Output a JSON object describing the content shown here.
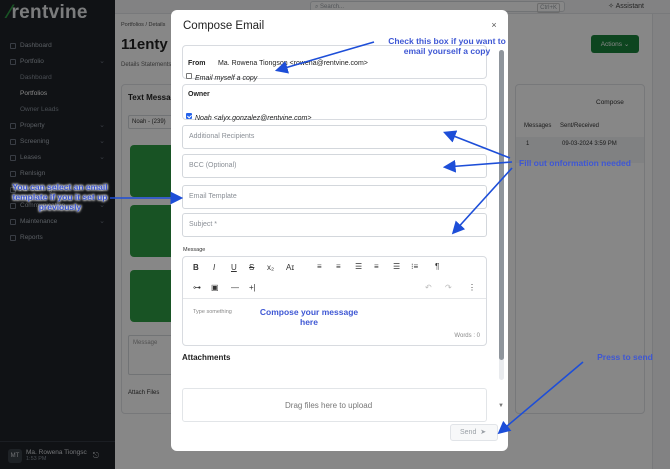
{
  "app": {
    "logo": "rentvine",
    "search_placeholder": "Search...",
    "search_shortcut": "Ctrl+K",
    "assistant_label": "Assistant"
  },
  "sidebar": {
    "items": [
      {
        "label": "Dashboard"
      },
      {
        "label": "Portfolio"
      },
      {
        "label": "Dashboard"
      },
      {
        "label": "Portfolios"
      },
      {
        "label": "Owner Leads"
      },
      {
        "label": "Property"
      },
      {
        "label": "Screening"
      },
      {
        "label": "Leases"
      },
      {
        "label": "Renlsign"
      },
      {
        "label": "Accounting"
      },
      {
        "label": "Communication"
      },
      {
        "label": "Maintenance"
      },
      {
        "label": "Reports"
      }
    ],
    "user_initials": "MT",
    "user_name": "Ma. Rowena Tiongsc",
    "user_time": "1:53 PM"
  },
  "page": {
    "breadcrumb": "Portfolios / Details",
    "title": "11enty",
    "tabs_text": "Details  Statements",
    "actions_label": "Actions",
    "text_messages_title": "Text Messages",
    "contact_select": "Noah - (239)",
    "compose_label": "Compose",
    "table_headers": [
      "Messages",
      "Sent/Received"
    ],
    "table_row": [
      "1",
      "09-03-2024 3:59 PM"
    ],
    "message_placeholder": "Message",
    "attach_label": "Attach Files"
  },
  "modal": {
    "title": "Compose Email",
    "close": "×",
    "from_label": "From",
    "from_value": "Ma. Rowena Tiongson <rowena@rentvine.com>",
    "email_myself_label": "Email myself a copy",
    "owner_label": "Owner",
    "owner_value": "Noah <alyx.gonzalez@rentvine.com>",
    "additional_recipients_placeholder": "Additional Recipients",
    "bcc_placeholder": "BCC (Optional)",
    "email_template_placeholder": "Email Template",
    "subject_placeholder": "Subject *",
    "message_label": "Message",
    "editor_placeholder": "Type something",
    "words_count": "Words : 0",
    "attachments_label": "Attachments",
    "dropzone_text": "Drag files here to upload",
    "send_label": "Send"
  },
  "annotations": {
    "checkbox_note": "Check this box if you want to email yourself a copy",
    "fill_out_note": "Fill out onformation needed",
    "template_note": "You can select an email template if you it set up previously",
    "compose_note": "Compose your message here",
    "send_note": "Press to send"
  },
  "colors": {
    "sidebar_bg": "#1f2328",
    "brand_green": "#2f9e44",
    "annotation_blue": "#3e57d4",
    "arrow_blue": "#1d4ed8"
  }
}
